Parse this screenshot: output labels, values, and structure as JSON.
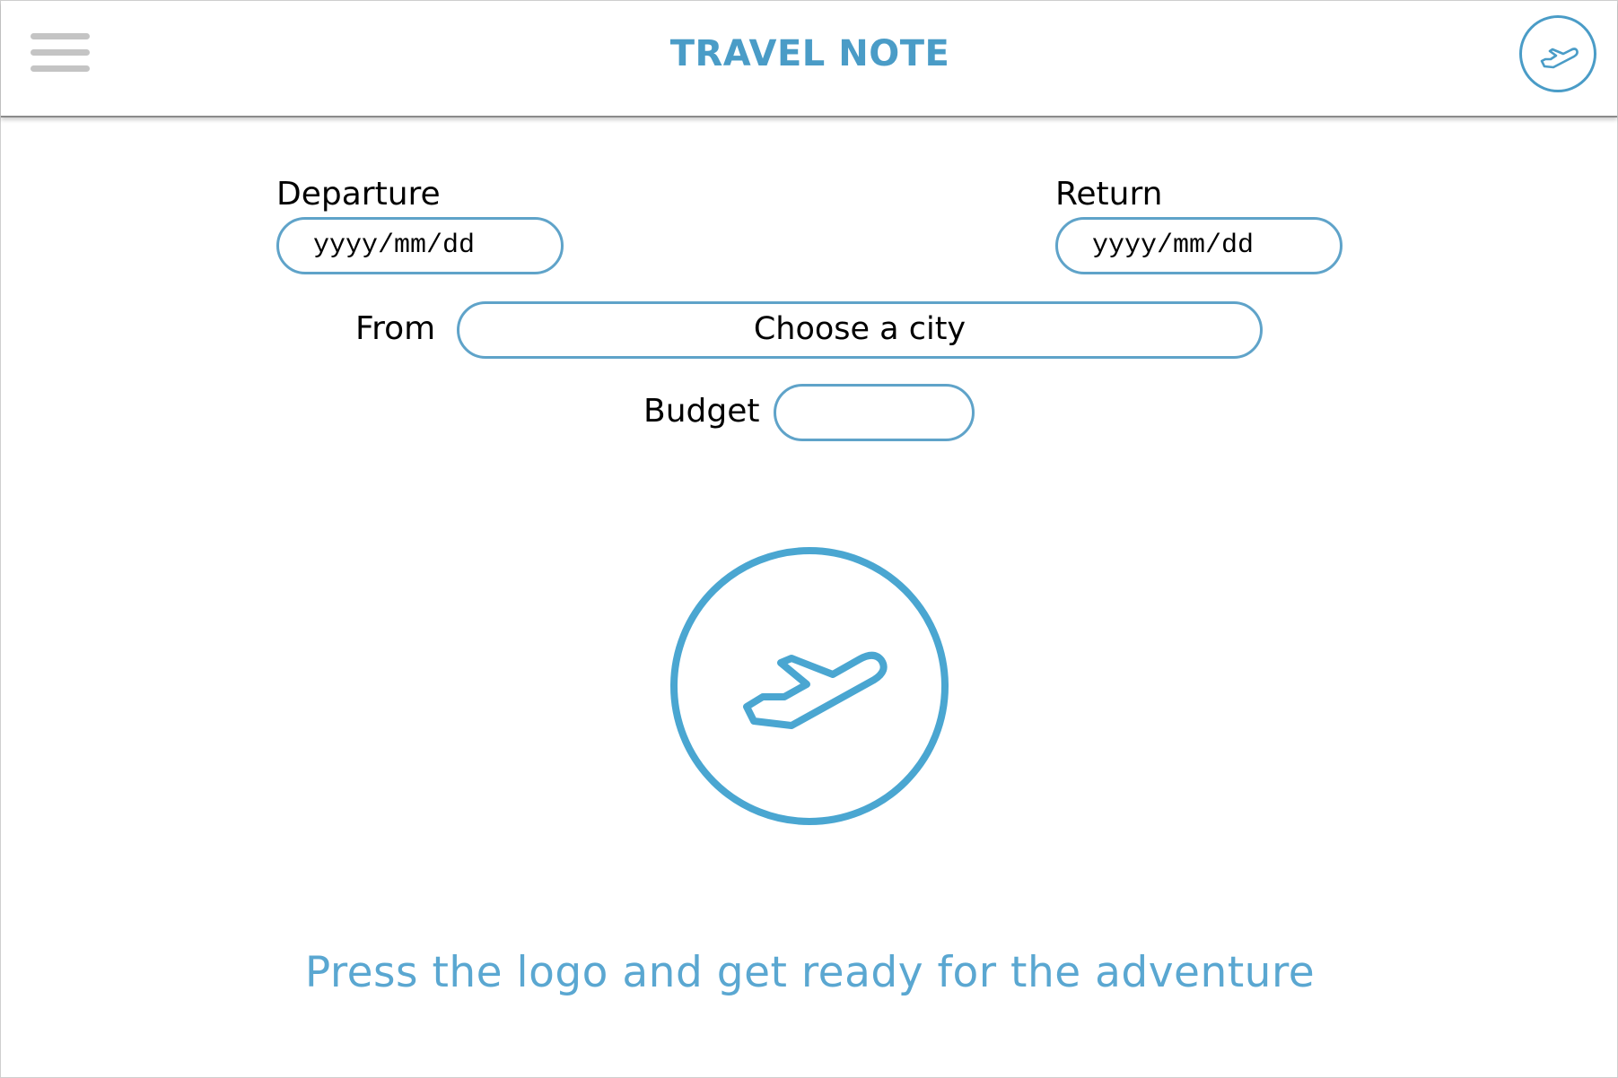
{
  "header": {
    "title": "TRAVEL NOTE",
    "menu_icon": "hamburger-menu-icon",
    "plane_icon": "airplane-takeoff-icon"
  },
  "form": {
    "departure": {
      "label": "Departure",
      "placeholder": "yyyy/mm/dd",
      "value": ""
    },
    "return": {
      "label": "Return",
      "placeholder": "yyyy/mm/dd",
      "value": ""
    },
    "from": {
      "label": "From",
      "selected": "Choose a city"
    },
    "budget": {
      "label": "Budget",
      "value": ""
    }
  },
  "logo": {
    "icon": "airplane-takeoff-icon"
  },
  "tagline": "Press the logo and get ready for the adventure",
  "colors": {
    "accent": "#4a9cc7",
    "field_border": "#5fa3c9",
    "menu_gray": "#c4c4c4"
  }
}
